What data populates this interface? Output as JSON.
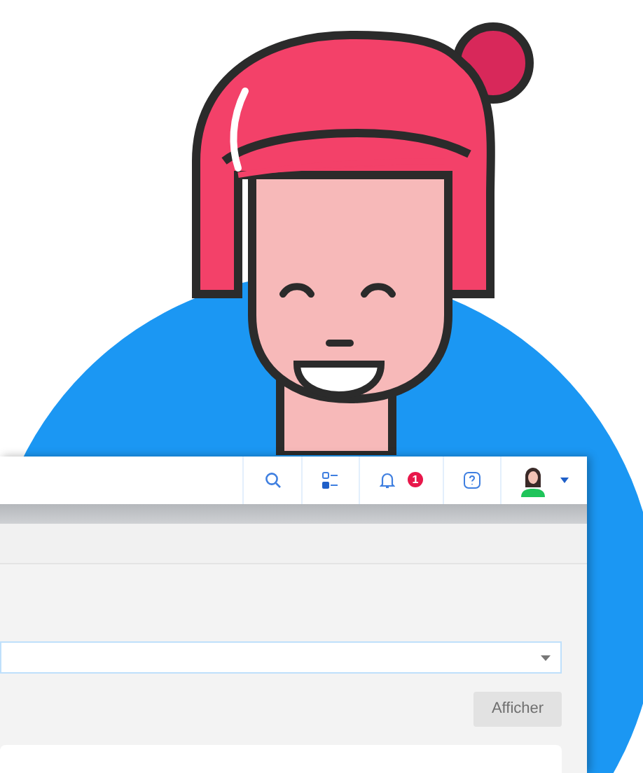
{
  "header": {
    "icons": [
      {
        "kind": "search"
      },
      {
        "kind": "tasks"
      },
      {
        "kind": "bell",
        "badge": "1"
      },
      {
        "kind": "help"
      },
      {
        "kind": "avatar"
      }
    ]
  },
  "form": {
    "select": {
      "kind": "dropdown"
    },
    "button": {
      "label": "Afficher",
      "disabled": true
    }
  }
}
